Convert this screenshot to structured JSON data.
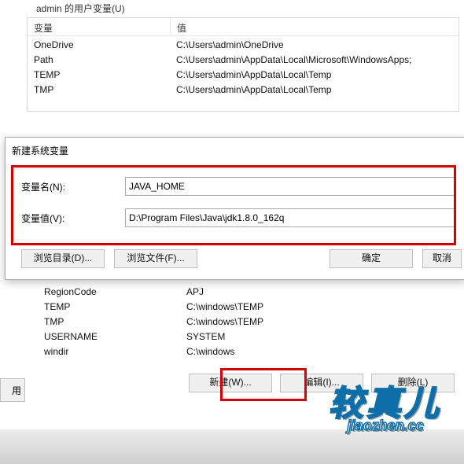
{
  "userVars": {
    "panelTitle": "admin 的用户变量(U)",
    "col1": "变量",
    "col2": "值",
    "rows": [
      {
        "name": "OneDrive",
        "value": "C:\\Users\\admin\\OneDrive"
      },
      {
        "name": "Path",
        "value": "C:\\Users\\admin\\AppData\\Local\\Microsoft\\WindowsApps;"
      },
      {
        "name": "TEMP",
        "value": "C:\\Users\\admin\\AppData\\Local\\Temp"
      },
      {
        "name": "TMP",
        "value": "C:\\Users\\admin\\AppData\\Local\\Temp"
      }
    ]
  },
  "dialog": {
    "title": "新建系统变量",
    "nameLabel": "变量名(N):",
    "nameValue": "JAVA_HOME",
    "valueLabel": "变量值(V):",
    "valueValue": "D:\\Program Files\\Java\\jdk1.8.0_162q",
    "browseDir": "浏览目录(D)...",
    "browseFile": "浏览文件(F)...",
    "ok": "确定",
    "cancel": "取消"
  },
  "sysVars": {
    "rows": [
      {
        "name": "RegionCode",
        "value": "APJ"
      },
      {
        "name": "TEMP",
        "value": "C:\\windows\\TEMP"
      },
      {
        "name": "TMP",
        "value": "C:\\windows\\TEMP"
      },
      {
        "name": "USERNAME",
        "value": "SYSTEM"
      },
      {
        "name": "windir",
        "value": "C:\\windows"
      }
    ]
  },
  "bottomButtons": {
    "new_": "新建(W)...",
    "edit": "编辑(I)...",
    "delete": "删除(L)"
  },
  "applyFragment": "用",
  "logo": {
    "cn": "较真儿",
    "py": "jiaozhen.cc"
  }
}
